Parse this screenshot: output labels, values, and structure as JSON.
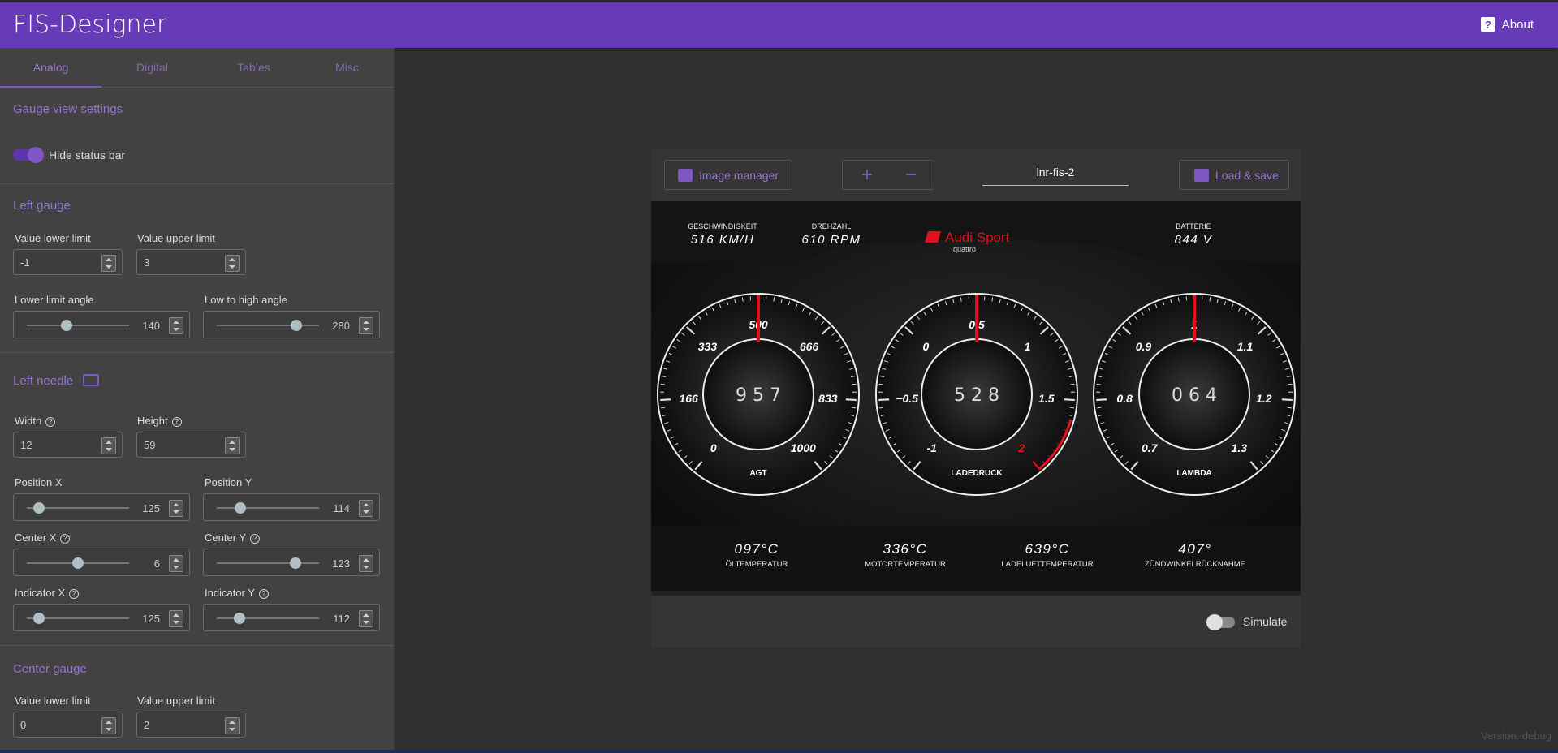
{
  "app": {
    "title": "FIS-Designer",
    "about_label": "About",
    "about_icon": "help-icon",
    "version": "Version: debug"
  },
  "tabs": [
    {
      "label": "Analog",
      "active": true
    },
    {
      "label": "Digital"
    },
    {
      "label": "Tables"
    },
    {
      "label": "Misc"
    }
  ],
  "gauge_view": {
    "title": "Gauge view settings",
    "hide_status_bar_label": "Hide status bar",
    "hide_status_bar_on": true
  },
  "left_gauge": {
    "title": "Left gauge",
    "lower_limit_label": "Value lower limit",
    "lower_limit": "-1",
    "upper_limit_label": "Value upper limit",
    "upper_limit": "3",
    "lower_angle_label": "Lower limit angle",
    "lower_angle": "140",
    "lower_angle_fraction": 0.39,
    "range_angle_label": "Low to high angle",
    "range_angle": "280",
    "range_angle_fraction": 0.78
  },
  "left_needle": {
    "title": "Left needle",
    "width_label": "Width",
    "width": "12",
    "height_label": "Height",
    "height": "59",
    "posx_label": "Position X",
    "posx": "125",
    "posx_fraction": 0.12,
    "posy_label": "Position Y",
    "posy": "114",
    "posy_fraction": 0.23,
    "centerx_label": "Center X",
    "centerx": "6",
    "centerx_fraction": 0.5,
    "centery_label": "Center Y",
    "centery": "123",
    "centery_fraction": 0.77,
    "indx_label": "Indicator X",
    "indx": "125",
    "indx_fraction": 0.12,
    "indy_label": "Indicator Y",
    "indy": "112",
    "indy_fraction": 0.22
  },
  "center_gauge": {
    "title": "Center gauge",
    "lower_limit_label": "Value lower limit",
    "lower_limit": "0",
    "upper_limit_label": "Value upper limit",
    "upper_limit": "2"
  },
  "toolbar": {
    "image_manager": "Image manager",
    "plus": "+",
    "minus": "−",
    "name": "lnr-fis-2",
    "load_save": "Load & save"
  },
  "dashboard": {
    "top": [
      {
        "label": "GESCHWINDIGKEIT",
        "value": "516 KM/H"
      },
      {
        "label": "DREHZAHL",
        "value": "610 RPM"
      },
      {
        "label": "BATTERIE",
        "value": "844 V"
      }
    ],
    "brand": "Audi Sport",
    "brand_sub": "quattro",
    "gauges": [
      {
        "name": "AGT",
        "digits": "9 5 7",
        "ticks": [
          "0",
          "166",
          "333",
          "500",
          "666",
          "833",
          "1000"
        ],
        "redline": false
      },
      {
        "name": "LADEDRUCK",
        "digits": "5 2 8",
        "ticks": [
          "-1",
          "−0.5",
          "0",
          "0.5",
          "1",
          "1.5",
          "2"
        ],
        "redline": true
      },
      {
        "name": "LAMBDA",
        "digits": "0 6 4",
        "ticks": [
          "0.7",
          "0.8",
          "0.9",
          "1",
          "1.1",
          "1.2",
          "1.3"
        ],
        "redline": false
      }
    ],
    "bottom": [
      {
        "value": "097°C",
        "label": "ÖLTEMPERATUR"
      },
      {
        "value": "336°C",
        "label": "MOTORTEMPERATUR"
      },
      {
        "value": "639°C",
        "label": "LADELUFTTEMPERATUR"
      },
      {
        "value": "407°",
        "label": "ZÜNDWINKELRÜCKNAHME"
      }
    ]
  },
  "simulate": {
    "label": "Simulate",
    "on": false
  },
  "colors": {
    "accent": "#673ab7",
    "accent_light": "#9575cd",
    "needle": "#e0101e",
    "redline": "#e0101e"
  }
}
